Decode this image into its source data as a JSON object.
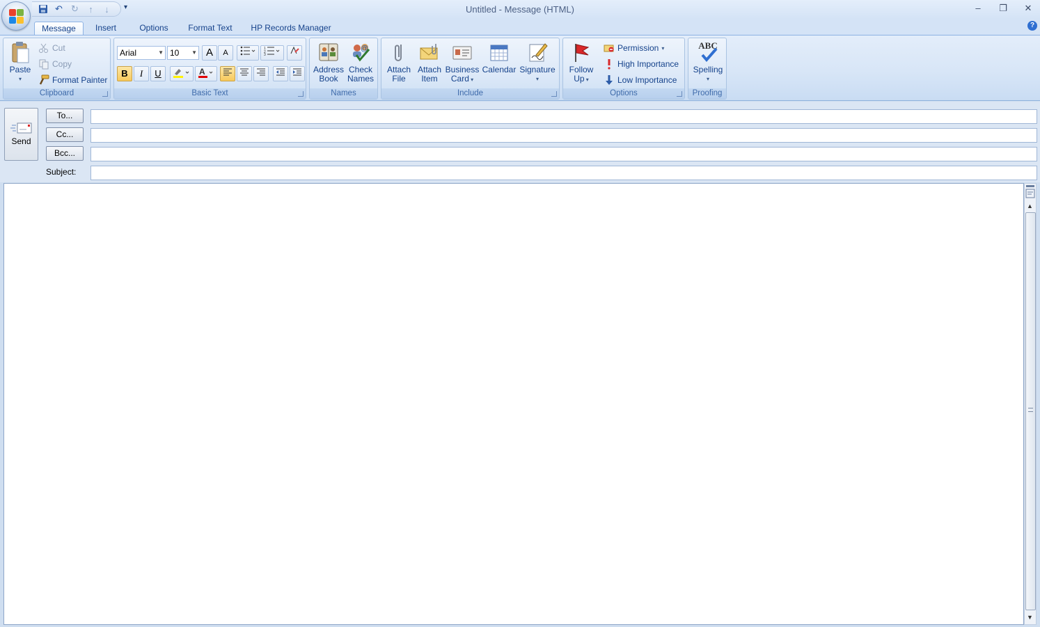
{
  "window": {
    "title": "Untitled - Message (HTML)",
    "controls": {
      "minimize": "–",
      "maximize": "❐",
      "close": "✕"
    }
  },
  "qat": {
    "save": "💾",
    "undo": "↶",
    "redo": "↻",
    "prev": "↑",
    "next": "↓",
    "customize": "▾"
  },
  "tabs": [
    "Message",
    "Insert",
    "Options",
    "Format Text",
    "HP Records Manager"
  ],
  "ribbon": {
    "clipboard": {
      "label": "Clipboard",
      "paste": "Paste",
      "cut": "Cut",
      "copy": "Copy",
      "format_painter": "Format Painter"
    },
    "basic_text": {
      "label": "Basic Text",
      "font": "Arial",
      "size": "10",
      "grow": "A",
      "shrink": "A",
      "bold": "B",
      "italic": "I",
      "underline": "U"
    },
    "names": {
      "label": "Names",
      "address_book": [
        "Address",
        "Book"
      ],
      "check_names": [
        "Check",
        "Names"
      ]
    },
    "include": {
      "label": "Include",
      "attach_file": [
        "Attach",
        "File"
      ],
      "attach_item": [
        "Attach",
        "Item"
      ],
      "business_card": [
        "Business",
        "Card"
      ],
      "calendar": "Calendar",
      "signature": "Signature"
    },
    "options": {
      "label": "Options",
      "follow_up": [
        "Follow",
        "Up"
      ],
      "permission": "Permission",
      "high_importance": "High Importance",
      "low_importance": "Low Importance"
    },
    "proofing": {
      "label": "Proofing",
      "spelling": "Spelling",
      "abc": "ABC"
    }
  },
  "compose": {
    "send": "Send",
    "to": "To...",
    "cc": "Cc...",
    "bcc": "Bcc...",
    "subject_label": "Subject:",
    "to_value": "",
    "cc_value": "",
    "bcc_value": "",
    "subject_value": ""
  },
  "colors": {
    "accent": "#15428b",
    "highlight": "#fff200",
    "font_color": "#e00000"
  }
}
